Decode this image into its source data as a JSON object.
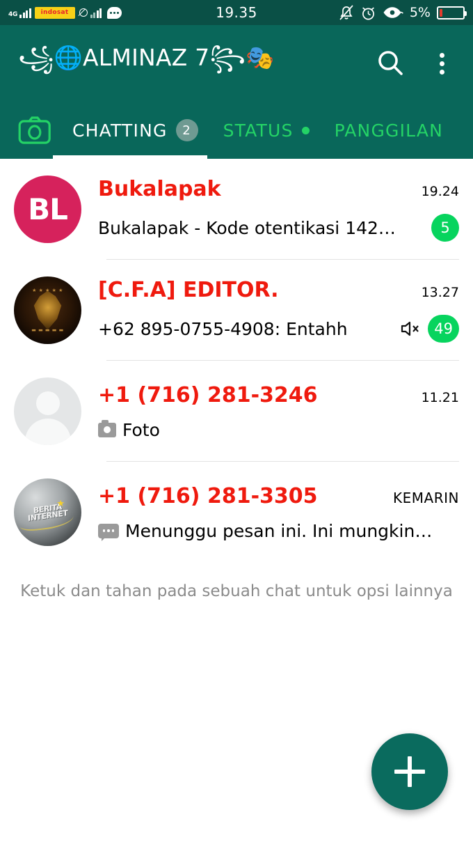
{
  "status_bar": {
    "network_type": "4G",
    "carrier": "indosat",
    "clock": "19.35",
    "battery_percent": "5%",
    "icons": [
      "signal-bars-icon",
      "carrier-logo",
      "signal-bars-dim-icon",
      "no-data-icon",
      "chat-notification-icon",
      "bell-muted-icon",
      "alarm-clock-icon",
      "eye-care-icon",
      "battery-icon"
    ]
  },
  "appbar": {
    "title": "꧁🌐ALMINAZ 7꧂🎭",
    "search_label": "search-icon",
    "menu_label": "overflow-menu-icon"
  },
  "tabs": {
    "camera_label": "camera-icon",
    "items": [
      {
        "label": "CHATTING",
        "badge": "2",
        "active": true,
        "dot": false
      },
      {
        "label": "STATUS",
        "badge": "",
        "active": false,
        "dot": true
      },
      {
        "label": "PANGGILAN",
        "badge": "",
        "active": false,
        "dot": false
      }
    ]
  },
  "chats": [
    {
      "name": "Bukalapak",
      "time": "19.24",
      "message": "Bukalapak - Kode otentikasi 142…",
      "badge": "5",
      "muted": false,
      "pre_icon": "",
      "avatar_type": "initials",
      "avatar_text": "BL"
    },
    {
      "name": "[C.F.A] EDITOR.",
      "time": "13.27",
      "message": "+62 895-0755-4908: Entahh",
      "badge": "49",
      "muted": true,
      "pre_icon": "",
      "avatar_type": "emblem",
      "avatar_text": ""
    },
    {
      "name": "+1 (716) 281-3246",
      "time": "11.21",
      "message": "Foto",
      "badge": "",
      "muted": false,
      "pre_icon": "camera-icon",
      "avatar_type": "default",
      "avatar_text": ""
    },
    {
      "name": "+1 (716) 281-3305",
      "time": "KEMARIN",
      "message": "Menunggu pesan ini. Ini mungkin…",
      "badge": "",
      "muted": false,
      "pre_icon": "message-bubble-icon",
      "avatar_type": "berita",
      "avatar_text": "BERITA INTERNET"
    }
  ],
  "hint": "Ketuk dan tahan pada sebuah chat untuk opsi lainnya",
  "fab": {
    "label": "new-chat-plus-icon"
  },
  "colors": {
    "status_bar": "#0a5046",
    "appbar": "#09675a",
    "tab_inactive": "#24d366",
    "badge_green": "#07d45e",
    "chat_name_red": "#ef1a0e",
    "fab": "#0a6b5e"
  }
}
